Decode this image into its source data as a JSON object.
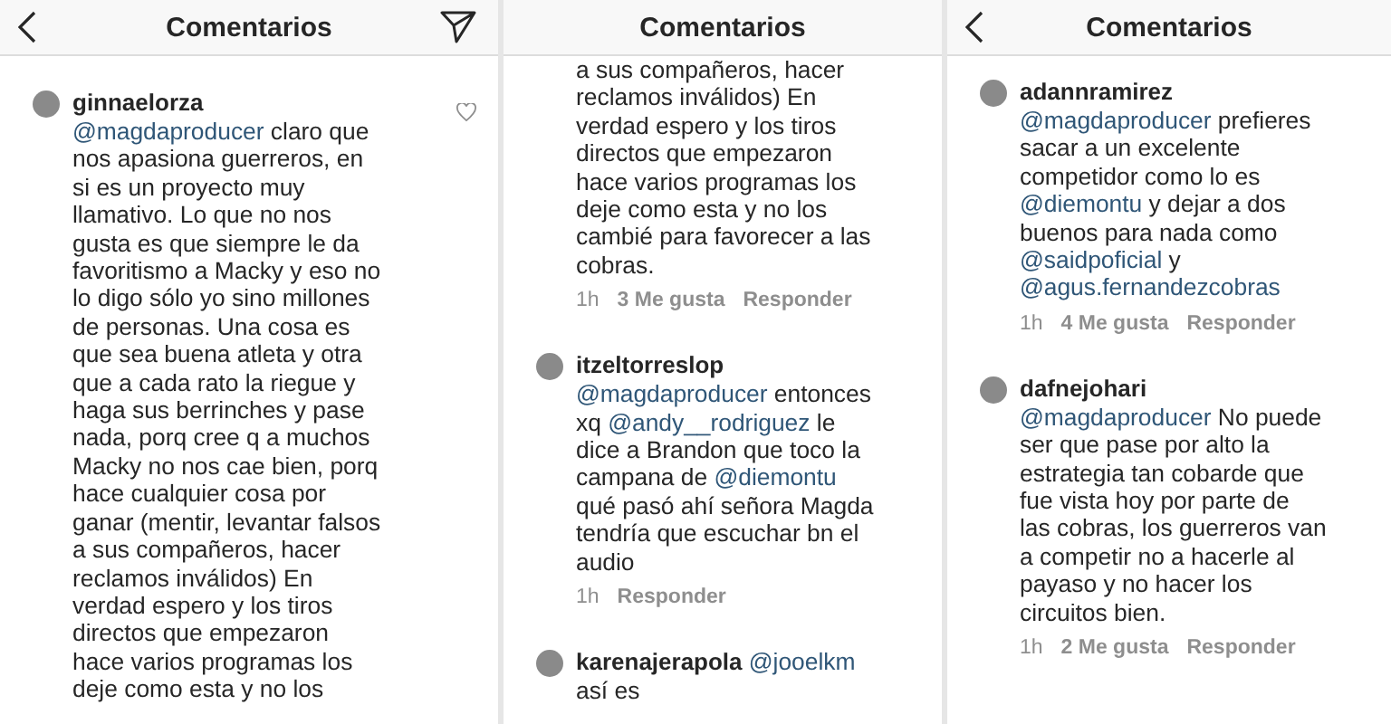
{
  "panels": [
    {
      "title": "Comentarios",
      "back": true,
      "send": true,
      "comments": [
        {
          "username": "ginnaelorza",
          "heart": true,
          "lines": [
            [
              {
                "kind": "mention",
                "text": "@magdaproducer"
              },
              {
                "kind": "text",
                "text": " claro que"
              }
            ],
            [
              {
                "kind": "text",
                "text": "nos apasiona guerreros, en"
              }
            ],
            [
              {
                "kind": "text",
                "text": "si es un proyecto muy"
              }
            ],
            [
              {
                "kind": "text",
                "text": "llamativo. Lo que no nos"
              }
            ],
            [
              {
                "kind": "text",
                "text": "gusta es que siempre le da"
              }
            ],
            [
              {
                "kind": "text",
                "text": "favoritismo a Macky y eso no"
              }
            ],
            [
              {
                "kind": "text",
                "text": "lo digo sólo yo sino millones"
              }
            ],
            [
              {
                "kind": "text",
                "text": "de personas. Una cosa es"
              }
            ],
            [
              {
                "kind": "text",
                "text": "que sea buena atleta y otra"
              }
            ],
            [
              {
                "kind": "text",
                "text": "que a cada rato la riegue y"
              }
            ],
            [
              {
                "kind": "text",
                "text": "haga sus berrinches y pase"
              }
            ],
            [
              {
                "kind": "text",
                "text": "nada, porq cree q a muchos"
              }
            ],
            [
              {
                "kind": "text",
                "text": "Macky no nos cae bien, porq"
              }
            ],
            [
              {
                "kind": "text",
                "text": "hace cualquier cosa por"
              }
            ],
            [
              {
                "kind": "text",
                "text": "ganar (mentir, levantar falsos"
              }
            ],
            [
              {
                "kind": "text",
                "text": "a sus compañeros, hacer"
              }
            ],
            [
              {
                "kind": "text",
                "text": "reclamos inválidos) En"
              }
            ],
            [
              {
                "kind": "text",
                "text": "verdad espero y los tiros"
              }
            ],
            [
              {
                "kind": "text",
                "text": "directos que empezaron"
              }
            ],
            [
              {
                "kind": "text",
                "text": "hace varios programas los"
              }
            ],
            [
              {
                "kind": "text",
                "text": "deje como esta y no los"
              }
            ]
          ]
        }
      ]
    },
    {
      "title": "Comentarios",
      "back": false,
      "send": false,
      "comments": [
        {
          "lines": [
            [
              {
                "kind": "text",
                "text": "a sus compañeros, hacer"
              }
            ],
            [
              {
                "kind": "text",
                "text": "reclamos inválidos) En"
              }
            ],
            [
              {
                "kind": "text",
                "text": "verdad espero y los tiros"
              }
            ],
            [
              {
                "kind": "text",
                "text": "directos que empezaron"
              }
            ],
            [
              {
                "kind": "text",
                "text": "hace varios programas los"
              }
            ],
            [
              {
                "kind": "text",
                "text": "deje como esta y no los"
              }
            ],
            [
              {
                "kind": "text",
                "text": "cambié para favorecer a las"
              }
            ],
            [
              {
                "kind": "text",
                "text": "cobras."
              }
            ]
          ],
          "time": "1h",
          "likes": "3 Me gusta",
          "reply": "Responder"
        },
        {
          "username": "itzeltorreslop",
          "lines": [
            [
              {
                "kind": "mention",
                "text": "@magdaproducer"
              },
              {
                "kind": "text",
                "text": " entonces"
              }
            ],
            [
              {
                "kind": "text",
                "text": "xq "
              },
              {
                "kind": "mention",
                "text": "@andy__rodriguez"
              },
              {
                "kind": "text",
                "text": "  le"
              }
            ],
            [
              {
                "kind": "text",
                "text": "dice a Brandon que toco la"
              }
            ],
            [
              {
                "kind": "text",
                "text": "campana de "
              },
              {
                "kind": "mention",
                "text": "@diemontu"
              }
            ],
            [
              {
                "kind": "text",
                "text": "qué pasó ahí señora Magda"
              }
            ],
            [
              {
                "kind": "text",
                "text": "tendría que escuchar bn el"
              }
            ],
            [
              {
                "kind": "text",
                "text": "audio"
              }
            ]
          ],
          "time": "1h",
          "reply": "Responder"
        },
        {
          "username": "karenajerapola",
          "lines": [
            [
              {
                "kind": "mention",
                "text": "@jooelkm"
              }
            ],
            [
              {
                "kind": "text",
                "text": "así es"
              }
            ]
          ],
          "inline": true
        }
      ]
    },
    {
      "title": "Comentarios",
      "back": true,
      "send": false,
      "comments": [
        {
          "username": "adannramirez",
          "lines": [
            [
              {
                "kind": "mention",
                "text": "@magdaproducer"
              },
              {
                "kind": "text",
                "text": " prefieres"
              }
            ],
            [
              {
                "kind": "text",
                "text": "sacar a un excelente"
              }
            ],
            [
              {
                "kind": "text",
                "text": "competidor como lo es"
              }
            ],
            [
              {
                "kind": "mention",
                "text": "@diemontu"
              },
              {
                "kind": "text",
                "text": "  y dejar a  dos"
              }
            ],
            [
              {
                "kind": "text",
                "text": "buenos para nada como"
              }
            ],
            [
              {
                "kind": "mention",
                "text": "@saidpoficial"
              },
              {
                "kind": "text",
                "text": "  y"
              }
            ],
            [
              {
                "kind": "mention",
                "text": "@agus.fernandezcobras"
              }
            ]
          ],
          "time": "1h",
          "likes": "4 Me gusta",
          "reply": "Responder"
        },
        {
          "username": "dafnejohari",
          "lines": [
            [
              {
                "kind": "mention",
                "text": "@magdaproducer"
              },
              {
                "kind": "text",
                "text": " No puede"
              }
            ],
            [
              {
                "kind": "text",
                "text": "ser que pase por alto la"
              }
            ],
            [
              {
                "kind": "text",
                "text": "estrategia tan cobarde que"
              }
            ],
            [
              {
                "kind": "text",
                "text": "fue vista hoy por parte de"
              }
            ],
            [
              {
                "kind": "text",
                "text": "las cobras, los guerreros van"
              }
            ],
            [
              {
                "kind": "text",
                "text": "a competir no a hacerle al"
              }
            ],
            [
              {
                "kind": "text",
                "text": "payaso y no hacer los"
              }
            ],
            [
              {
                "kind": "text",
                "text": "circuitos bien."
              }
            ]
          ],
          "time": "1h",
          "likes": "2 Me gusta",
          "reply": "Responder"
        }
      ]
    }
  ]
}
